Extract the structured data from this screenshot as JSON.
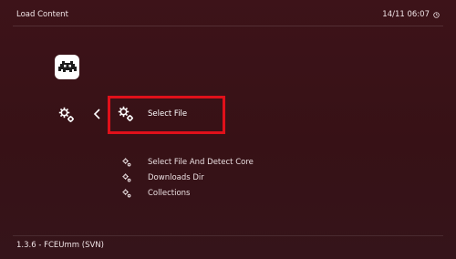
{
  "header": {
    "title": "Load Content",
    "datetime": "14/11 06:07"
  },
  "sidebar": {
    "logo_icon": "retroarch-invader-icon",
    "current_icon": "gear-icon",
    "back_icon": "chevron-left-icon"
  },
  "menu": {
    "selected": {
      "label": "Select File",
      "icon": "gear-icon"
    },
    "items": [
      {
        "label": "Select File And Detect Core",
        "icon": "gear-icon"
      },
      {
        "label": "Downloads Dir",
        "icon": "gear-icon"
      },
      {
        "label": "Collections",
        "icon": "gear-icon"
      }
    ]
  },
  "footer": {
    "version": "1.3.6 - FCEUmm (SVN)"
  },
  "colors": {
    "background": "#3a1217",
    "highlight_box": "#e0101a",
    "text": "#ffffff"
  }
}
